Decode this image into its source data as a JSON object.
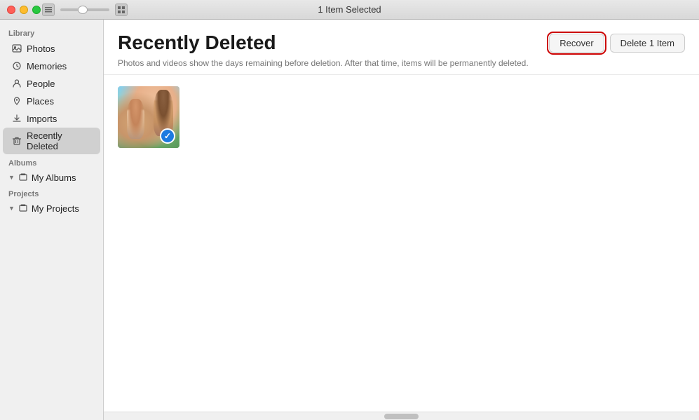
{
  "titlebar": {
    "title": "1 Item Selected",
    "controls": {
      "close": "×",
      "minimize": "−",
      "maximize": "+"
    }
  },
  "sidebar": {
    "library_label": "Library",
    "albums_label": "Albums",
    "projects_label": "Projects",
    "items": [
      {
        "id": "photos",
        "label": "Photos",
        "icon": "photo"
      },
      {
        "id": "memories",
        "label": "Memories",
        "icon": "memory"
      },
      {
        "id": "people",
        "label": "People",
        "icon": "person"
      },
      {
        "id": "places",
        "label": "Places",
        "icon": "pin"
      },
      {
        "id": "imports",
        "label": "Imports",
        "icon": "import"
      },
      {
        "id": "recently-deleted",
        "label": "Recently Deleted",
        "icon": "trash",
        "active": true
      }
    ],
    "my_albums": {
      "label": "My Albums",
      "icon": "album"
    },
    "my_projects": {
      "label": "My Projects",
      "icon": "project"
    }
  },
  "main": {
    "title": "Recently Deleted",
    "subtitle": "Photos and videos show the days remaining before deletion. After that time, items will be permanently deleted.",
    "recover_button": "Recover",
    "delete_button": "Delete 1 Item",
    "photos": [
      {
        "id": "photo-1",
        "selected": true,
        "check_icon": "✓"
      }
    ]
  }
}
